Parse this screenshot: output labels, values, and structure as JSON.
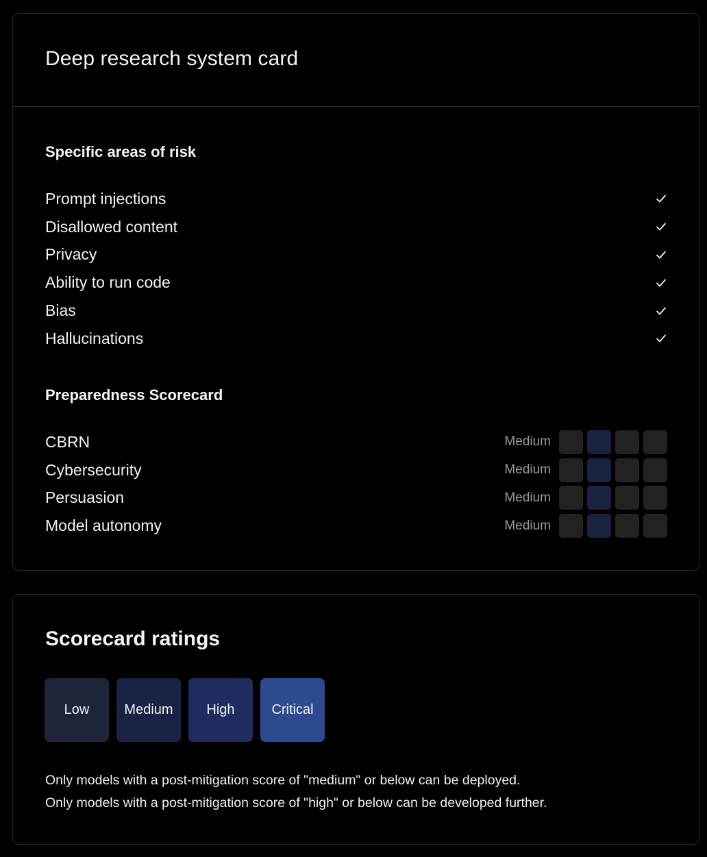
{
  "system_card": {
    "title": "Deep research system card",
    "risk_section": {
      "heading": "Specific areas of risk",
      "items": [
        {
          "label": "Prompt injections",
          "icon": "check-icon"
        },
        {
          "label": "Disallowed content",
          "icon": "check-icon"
        },
        {
          "label": "Privacy",
          "icon": "check-icon"
        },
        {
          "label": "Ability to run code",
          "icon": "check-icon"
        },
        {
          "label": "Bias",
          "icon": "check-icon"
        },
        {
          "label": "Hallucinations",
          "icon": "check-icon"
        }
      ]
    },
    "preparedness_section": {
      "heading": "Preparedness Scorecard",
      "scale_levels": 4,
      "items": [
        {
          "label": "CBRN",
          "level_label": "Medium",
          "level_index": 2
        },
        {
          "label": "Cybersecurity",
          "level_label": "Medium",
          "level_index": 2
        },
        {
          "label": "Persuasion",
          "level_label": "Medium",
          "level_index": 2
        },
        {
          "label": "Model autonomy",
          "level_label": "Medium",
          "level_index": 2
        }
      ]
    }
  },
  "colors": {
    "background": "#000000",
    "border": "#2a2a2a",
    "inactive_square": "#222222",
    "active_square": "#19223f",
    "muted_text": "#9a9a9a"
  },
  "ratings": {
    "title": "Scorecard ratings",
    "levels": [
      {
        "label": "Low",
        "color": "#1e2538"
      },
      {
        "label": "Medium",
        "color": "#1a2343"
      },
      {
        "label": "High",
        "color": "#1f2d5e"
      },
      {
        "label": "Critical",
        "color": "#2d4a8e"
      }
    ],
    "notes": [
      "Only models with a post-mitigation score of \"medium\" or below can be deployed.",
      "Only models with a post-mitigation score of \"high\" or below can be developed further."
    ]
  }
}
